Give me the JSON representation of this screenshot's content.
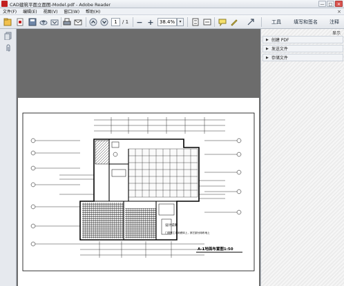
{
  "window": {
    "title": "CAD建筑平面立面图-Model.pdf - Adobe Reader",
    "controls": [
      "—",
      "□",
      "✕"
    ]
  },
  "menu": {
    "items": [
      "文件(F)",
      "编辑(E)",
      "视图(V)",
      "窗口(W)",
      "帮助(H)"
    ],
    "close": "×"
  },
  "toolbar": {
    "page_current": "1",
    "page_total": "/ 1",
    "zoom": "38.4%",
    "zoom_out": "−",
    "zoom_in": "+",
    "tools_tab": "工具",
    "fill_sign_tab": "填写和签名",
    "comment_tab": "注释"
  },
  "right_panel": {
    "show_label": "显示",
    "items": [
      "创建 PDF",
      "发送文件",
      "存储文件"
    ]
  },
  "drawing": {
    "plan_title": "A-1地面布置图1:50",
    "note_title": "设计说明",
    "note_line": "门洞需工本用瓷砖上，其它部分用布地上"
  },
  "colors": {
    "document_bg": "#6c6c6c",
    "accent": "#c21f1f"
  }
}
